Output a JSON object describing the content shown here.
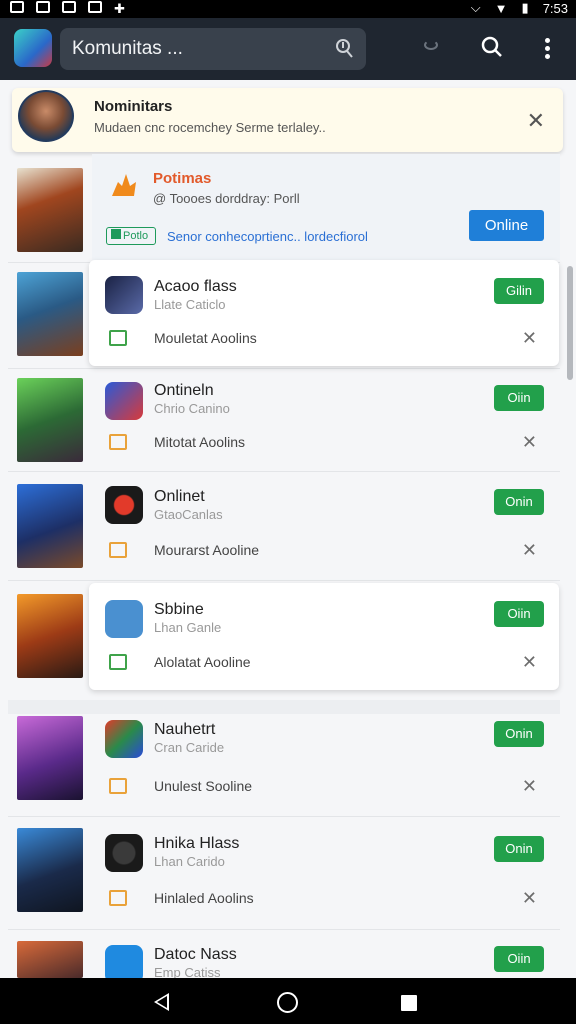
{
  "status_bar": {
    "time": "7:53"
  },
  "app_bar": {
    "search_text": "Komunitas ..."
  },
  "banner": {
    "title": "Nominitars",
    "subtitle": "Mudaen cnc rocemchey Serme terlaley.."
  },
  "promo": {
    "title": "Potimas",
    "subtitle": "@ Toooes dorddray: Porll",
    "badge": "Potlo",
    "link": "Senor conhecoprtienc.. lordecfiorol",
    "button": "Online"
  },
  "items": [
    {
      "name": "Acaoo flass",
      "sub": "Llate Caticlo",
      "button": "Gilin",
      "tag": "Mouletat Aoolins"
    },
    {
      "name": "Ontineln",
      "sub": "Chrio Canino",
      "button": "Oiin",
      "tag": "Mitotat Aoolins"
    },
    {
      "name": "Onlinet",
      "sub": "GtaoCanlas",
      "button": "Onin",
      "tag": "Mourarst Aooline"
    },
    {
      "name": "Sbbine",
      "sub": "Lhan Ganle",
      "button": "Oiin",
      "tag": "Alolatat Aooline"
    },
    {
      "name": "Nauhetrt",
      "sub": "Cran Caride",
      "button": "Onin",
      "tag": "Unulest Sooline"
    },
    {
      "name": "Hnika Hlass",
      "sub": "Lhan Carido",
      "button": "Onin",
      "tag": "Hinlaled Aoolins"
    },
    {
      "name": "Datoc Nass",
      "sub": "Emp Catiss",
      "button": "Oiin",
      "tag": ""
    }
  ],
  "colors": {
    "accent_green": "#22a04b",
    "accent_blue": "#1f7fd8",
    "app_bar": "#1f2630"
  }
}
